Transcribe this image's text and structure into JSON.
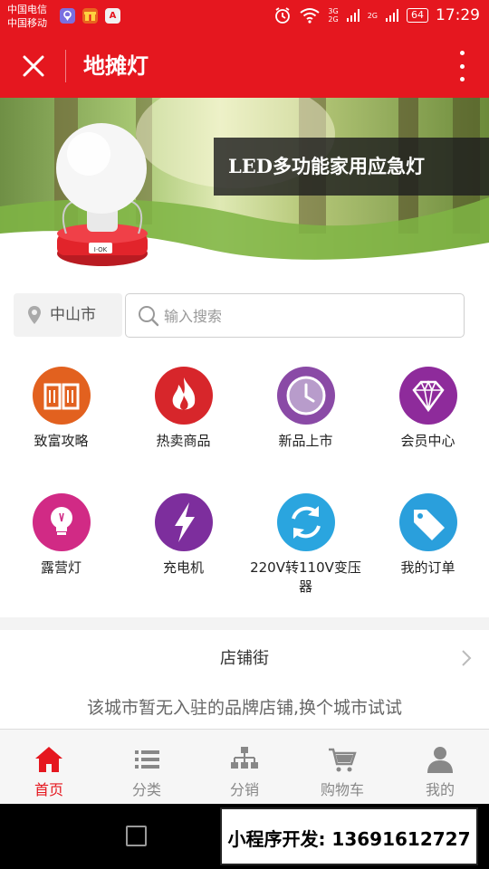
{
  "status_bar": {
    "carrier_1": "中国电信",
    "carrier_2": "中国移动",
    "network_1": "3G",
    "network_2": "2G",
    "network_3": "2G",
    "battery": "64",
    "time": "17:29",
    "app_icon_3": "A"
  },
  "title_bar": {
    "title": "地摊灯"
  },
  "banner": {
    "caption": "LED多功能家用应急灯",
    "lamp_switch_label": "I·OK"
  },
  "search": {
    "city": "中山市",
    "placeholder": "输入搜索"
  },
  "categories": [
    {
      "label": "致富攻略",
      "icon": "book-icon",
      "color": "#e2611f"
    },
    {
      "label": "热卖商品",
      "icon": "fire-icon",
      "color": "#d7262b"
    },
    {
      "label": "新品上市",
      "icon": "clock-icon",
      "color": "#8a4aa6"
    },
    {
      "label": "会员中心",
      "icon": "diamond-icon",
      "color": "#8e2b9b"
    },
    {
      "label": "露营灯",
      "icon": "bulb-icon",
      "color": "#d12a85"
    },
    {
      "label": "充电机",
      "icon": "lightning-icon",
      "color": "#7d2e9d"
    },
    {
      "label": "220V转110V变压器",
      "icon": "refresh-icon",
      "color": "#2aa5df"
    },
    {
      "label": "我的订单",
      "icon": "tag-icon",
      "color": "#2a9fdc"
    }
  ],
  "shop_street": {
    "title": "店铺街",
    "empty_message": "该城市暂无入驻的品牌店铺,换个城市试试"
  },
  "tab_bar": {
    "tabs": [
      {
        "label": "首页",
        "icon": "home-icon",
        "active": true
      },
      {
        "label": "分类",
        "icon": "list-icon",
        "active": false
      },
      {
        "label": "分销",
        "icon": "hierarchy-icon",
        "active": false
      },
      {
        "label": "购物车",
        "icon": "cart-icon",
        "active": false
      },
      {
        "label": "我的",
        "icon": "user-icon",
        "active": false
      }
    ]
  },
  "contact_overlay": {
    "text": "小程序开发: 13691612727"
  },
  "colors": {
    "brand": "#e5171f",
    "tab_inactive": "#888888"
  }
}
